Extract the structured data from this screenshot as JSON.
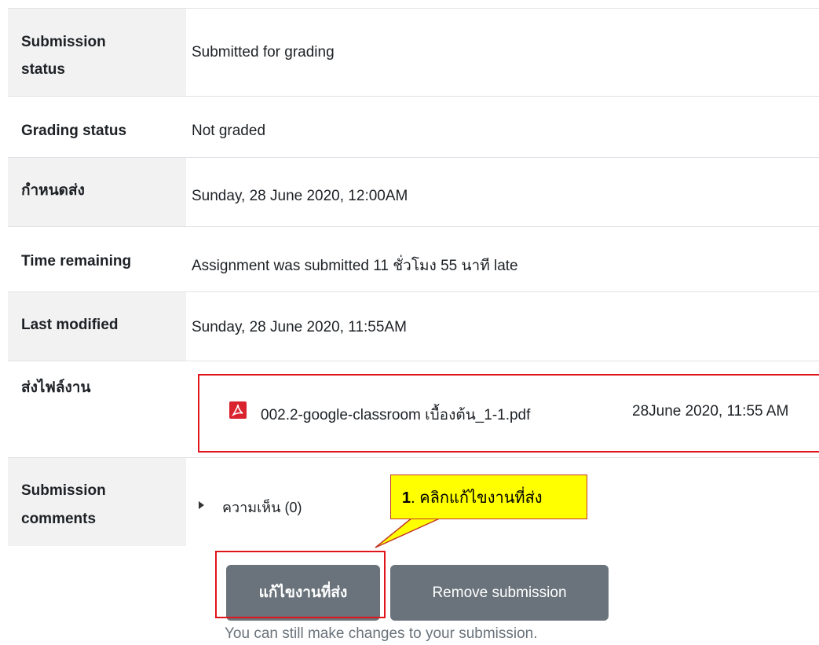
{
  "rows": [
    {
      "label_line1": "Submission",
      "label_line2": "status",
      "value": "Submitted for grading"
    },
    {
      "label": "Grading status",
      "value": "Not graded"
    },
    {
      "label": "กำหนดส่ง",
      "value": "Sunday, 28 June 2020, 12:00AM"
    },
    {
      "label": "Time remaining",
      "value": "Assignment was submitted 11 ชั่วโมง 55 นาที late"
    },
    {
      "label": "Last modified",
      "value": "Sunday, 28 June 2020, 11:55AM"
    },
    {
      "label": "ส่งไฟล์งาน"
    },
    {
      "label_line1": "Submission",
      "label_line2": "comments"
    }
  ],
  "file": {
    "name": "002.2-google-classroom เบื้องต้น_1-1.pdf",
    "date": "28June 2020, 11:55 AM",
    "icon": "pdf-icon"
  },
  "comments": {
    "label": "ความเห็น (0)"
  },
  "callout": {
    "number": "1",
    "text": ". คลิกแก้ไขงานที่ส่ง"
  },
  "buttons": {
    "edit": "แก้ไขงานที่ส่ง",
    "remove": "Remove submission"
  },
  "note": "You can still make changes to your submission.",
  "colors": {
    "shaded": "#f2f2f2",
    "button": "#6a737b",
    "highlight": "#e0141b",
    "callout": "#ffff00"
  }
}
